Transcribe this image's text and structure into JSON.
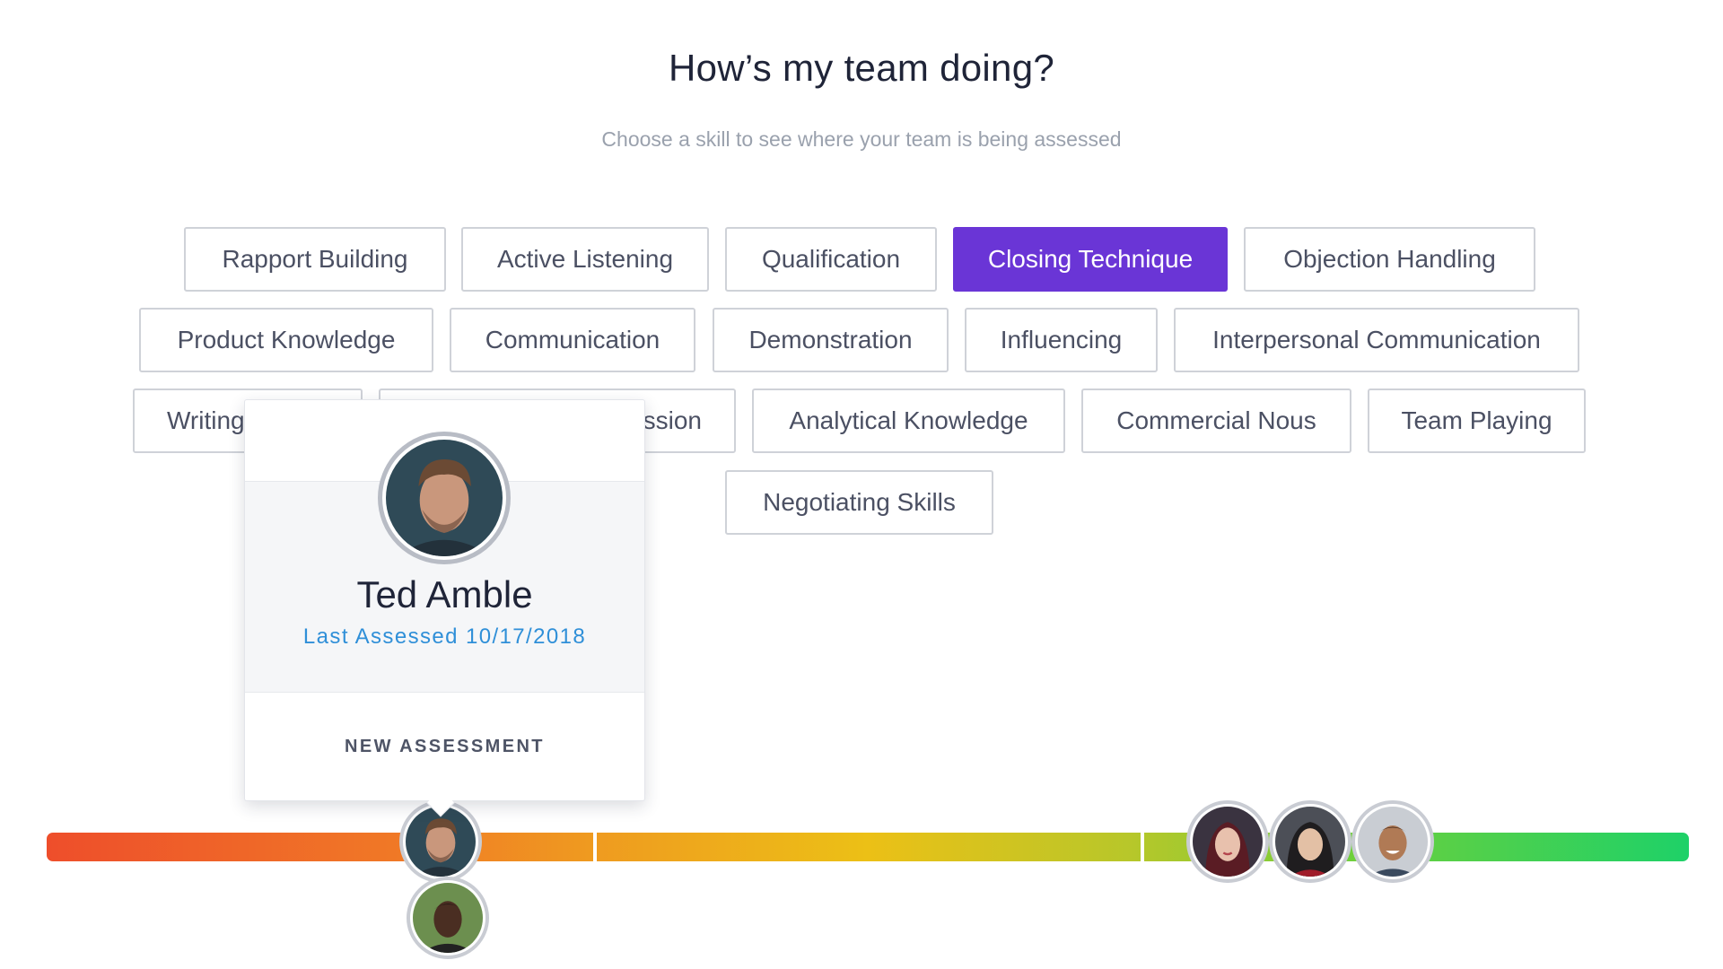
{
  "header": {
    "title": "How’s my team doing?",
    "subtitle": "Choose a skill to see where your team is being assessed"
  },
  "skills": [
    "Rapport Building",
    "Active Listening",
    "Qualification",
    "Closing Technique",
    "Objection Handling",
    "Product Knowledge",
    "Communication",
    "Demonstration",
    "Influencing",
    "Interpersonal Communication",
    "Writing",
    "ssion",
    "Analytical Knowledge",
    "Commercial Nous",
    "Team Playing",
    "Negotiating Skills"
  ],
  "selected_skill": "Closing Technique",
  "popover": {
    "name": "Ted Amble",
    "last_assessed": "Last Assessed 10/17/2018",
    "action_label": "NEW ASSESSMENT"
  },
  "colors": {
    "accent": "#6a35d6",
    "link": "#2f8fd8",
    "scale_low": "#ee4e2b",
    "scale_mid": "#ecc016",
    "scale_high": "#1ed168"
  },
  "icons": [
    "avatar-ted-amble",
    "avatar-team-member"
  ]
}
